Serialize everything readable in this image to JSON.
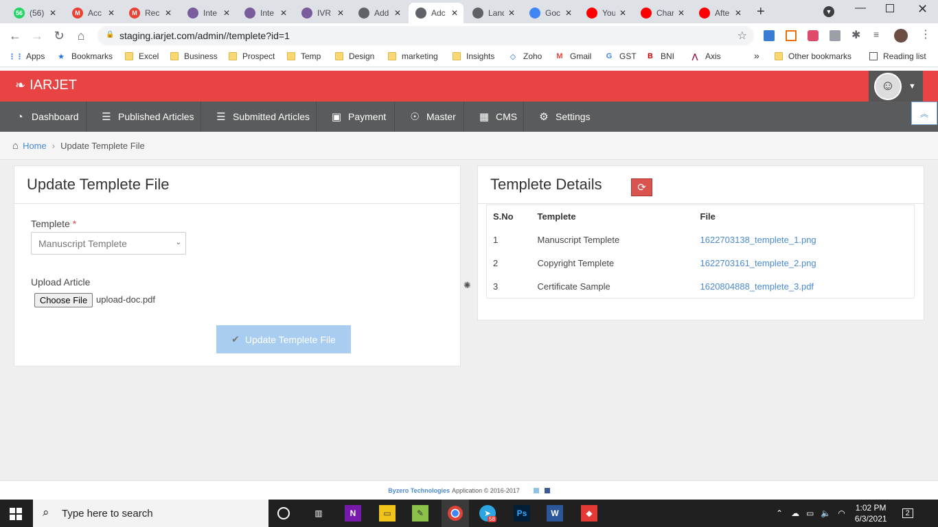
{
  "browser": {
    "tabs": [
      {
        "title": "(56)",
        "icon": "whatsapp-icon",
        "color": "#25d366",
        "badge": "56"
      },
      {
        "title": "Acc",
        "icon": "gmail-icon",
        "color": "#ea4335",
        "badge": "M"
      },
      {
        "title": "Rec",
        "icon": "gmail-icon",
        "color": "#ea4335",
        "badge": "M"
      },
      {
        "title": "Inte",
        "icon": "globe-icon",
        "color": "#7a5c9c",
        "badge": ""
      },
      {
        "title": "Inte",
        "icon": "globe-icon",
        "color": "#7a5c9c",
        "badge": ""
      },
      {
        "title": "IVR",
        "icon": "globe-icon",
        "color": "#7a5c9c",
        "badge": ""
      },
      {
        "title": "Add Jou",
        "icon": "globe-icon",
        "color": "#5f6368",
        "badge": ""
      },
      {
        "title": "Adc",
        "icon": "globe-icon",
        "color": "#5f6368",
        "badge": ""
      },
      {
        "title": "Landing",
        "icon": "globe-icon",
        "color": "#5f6368",
        "badge": ""
      },
      {
        "title": "Goc",
        "icon": "google-icon",
        "color": "#4285f4",
        "badge": ""
      },
      {
        "title": "You",
        "icon": "youtube-icon",
        "color": "#ff0000",
        "badge": ""
      },
      {
        "title": "Charact",
        "icon": "youtube-icon",
        "color": "#ff0000",
        "badge": ""
      },
      {
        "title": "Afte",
        "icon": "youtube-icon",
        "color": "#ff0000",
        "badge": ""
      }
    ],
    "url": "staging.iarjet.com/admin//templete?id=1",
    "bookmarks": [
      {
        "label": "Apps",
        "type": "apps"
      },
      {
        "label": "Bookmarks",
        "type": "star"
      },
      {
        "label": "Excel",
        "type": "folder"
      },
      {
        "label": "Business",
        "type": "folder"
      },
      {
        "label": "Prospect",
        "type": "folder"
      },
      {
        "label": "Temp",
        "type": "folder"
      },
      {
        "label": "Design",
        "type": "folder"
      },
      {
        "label": "marketing",
        "type": "folder"
      },
      {
        "label": "Insights",
        "type": "folder"
      },
      {
        "label": "Zoho",
        "type": "zoho"
      },
      {
        "label": "Gmail",
        "type": "gmail"
      },
      {
        "label": "GST",
        "type": "google"
      },
      {
        "label": "BNI",
        "type": "bni"
      },
      {
        "label": "Axis",
        "type": "axis"
      }
    ],
    "more_bookmarks": "»",
    "other_bookmarks": "Other bookmarks",
    "reading_list": "Reading list"
  },
  "app": {
    "brand": "IARJET",
    "brand_color": "#e84444",
    "nav": [
      {
        "label": "Dashboard",
        "icon": "dashboard-icon"
      },
      {
        "label": "Published Articles",
        "icon": "database-icon"
      },
      {
        "label": "Submitted Articles",
        "icon": "database-icon"
      },
      {
        "label": "Payment",
        "icon": "money-icon"
      },
      {
        "label": "Master",
        "icon": "person-icon"
      },
      {
        "label": "CMS",
        "icon": "building-icon"
      },
      {
        "label": "Settings",
        "icon": "gear-icon"
      }
    ],
    "breadcrumb": {
      "home": "Home",
      "current": "Update Templete File"
    }
  },
  "form_panel": {
    "title": "Update Templete File",
    "templete_label": "Templete",
    "required_mark": "*",
    "templete_value": "Manuscript Templete",
    "upload_label": "Upload Article",
    "choose_file": "Choose File",
    "file_name": "upload-doc.pdf",
    "submit_label": "Update Templete File"
  },
  "details_panel": {
    "title": "Templete Details",
    "headers": [
      "S.No",
      "Templete",
      "File"
    ],
    "rows": [
      {
        "sno": "1",
        "templete": "Manuscript Templete",
        "file": "1622703138_templete_1.png"
      },
      {
        "sno": "2",
        "templete": "Copyright Templete",
        "file": "1622703161_templete_2.png"
      },
      {
        "sno": "3",
        "templete": "Certificate Sample",
        "file": "1620804888_templete_3.pdf"
      }
    ]
  },
  "footer": {
    "company": "Byzero Technologies",
    "text": "Application © 2016-2017"
  },
  "taskbar": {
    "search_placeholder": "Type here to search",
    "time": "1:02 PM",
    "date": "6/3/2021",
    "notifications": "2",
    "telegram_badge": "58"
  }
}
